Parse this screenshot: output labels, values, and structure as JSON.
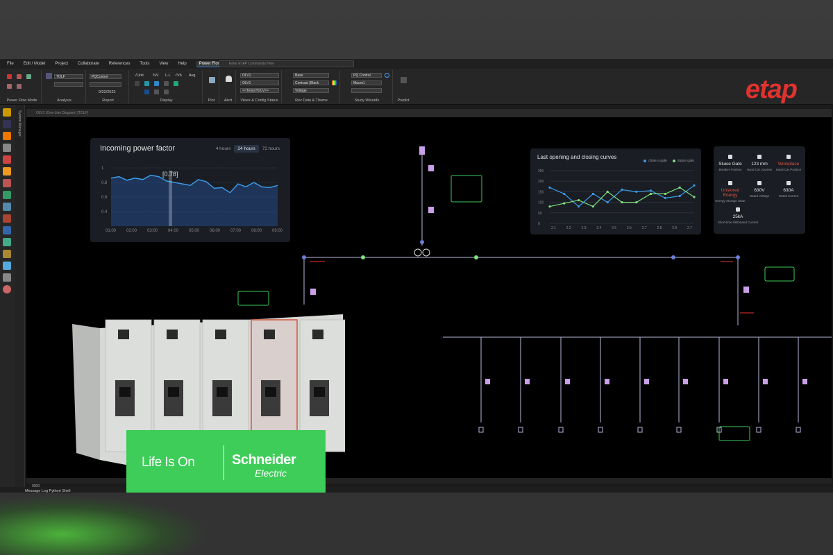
{
  "menu": [
    "File",
    "Edit / Model",
    "Project",
    "Collaborate",
    "References",
    "Tools",
    "View",
    "Help",
    "Power Flow"
  ],
  "command_placeholder": "Enter ETAP Commands Here",
  "ribbon": {
    "groups": [
      "Power Flow Mode",
      "Analysis",
      "Report",
      "Display",
      "Plot",
      "Alert",
      "Views & Config Status",
      "Rev Data & Theme",
      "Study Wizards",
      "Predict"
    ],
    "analysis_case": "TOLF",
    "report_case": "PQControl",
    "report_date": "9/22/2023",
    "display_labels": [
      "√Unit",
      "%V",
      "L-L",
      "√Vb",
      "Avg"
    ],
    "views": [
      "OLV1",
      "OLV1",
      "<<Temp/TOLV>>"
    ],
    "rev_data": [
      "Base",
      "Contrast (Black",
      "Voltage"
    ],
    "study": [
      "PQ Control",
      "Macro1",
      ""
    ]
  },
  "brand": "etap",
  "left_panel_label": "System Manager",
  "doc_tab": "OLV1 (One-Line Diagram) [TOLF]",
  "statusbar_tab": "0000",
  "message_bar": "Message Log   Python Shell",
  "power_factor": {
    "title": "Incoming power factor",
    "tabs": [
      "4 hours",
      "24 hours",
      "72 hours"
    ],
    "active_tab": "24 hours",
    "highlight": "0.78",
    "yticks": [
      "1",
      "0.8",
      "0.6",
      "0.4"
    ],
    "xticks": [
      "01:00",
      "02:00",
      "03:00",
      "04:00",
      "05:00",
      "06:00",
      "07:00",
      "08:00",
      "09:00"
    ],
    "line_color": "#3a9be8"
  },
  "curves": {
    "title": "Last opening and closing curves",
    "legend": [
      "close a gate",
      "sluice gate"
    ],
    "colors": [
      "#3a9be8",
      "#7fe37f"
    ],
    "yticks": [
      "250",
      "200",
      "150",
      "100",
      "50",
      "0"
    ],
    "xticks": [
      "2.1",
      "2.2",
      "2.3",
      "2.4",
      "2.5",
      "2.6",
      "2.7",
      "2.8",
      "2.9",
      "2.7"
    ],
    "close_gate": [
      170,
      140,
      80,
      140,
      100,
      160,
      150,
      155,
      120,
      130,
      180
    ],
    "sluice_gate": [
      80,
      95,
      110,
      80,
      150,
      100,
      100,
      140,
      140,
      170,
      125
    ]
  },
  "info_panel": [
    {
      "icon": "gate-icon",
      "value": "Sluice Gate",
      "label": "Breaker Position",
      "alert": false
    },
    {
      "icon": "ruler-icon",
      "value": "123 mm",
      "label": "Hand Car Journey",
      "alert": false
    },
    {
      "icon": "hand-icon",
      "value": "Workplace",
      "label": "Hand Car Position",
      "alert": true
    },
    {
      "icon": "battery-icon",
      "value": "Unstored Energy",
      "label": "Energy Storage State",
      "alert": true
    },
    {
      "icon": "voltage-icon",
      "value": "630V",
      "label": "Rated Voltage",
      "alert": false
    },
    {
      "icon": "current-icon",
      "value": "630A",
      "label": "Rated Current",
      "alert": false
    },
    {
      "icon": "bolt-icon",
      "value": "25kA",
      "label": "Short-time Withstand Current",
      "alert": false
    }
  ],
  "schneider": {
    "tagline": "Life Is On",
    "name": "Schneider",
    "sub": "Electric",
    "color": "#3dcd58"
  }
}
